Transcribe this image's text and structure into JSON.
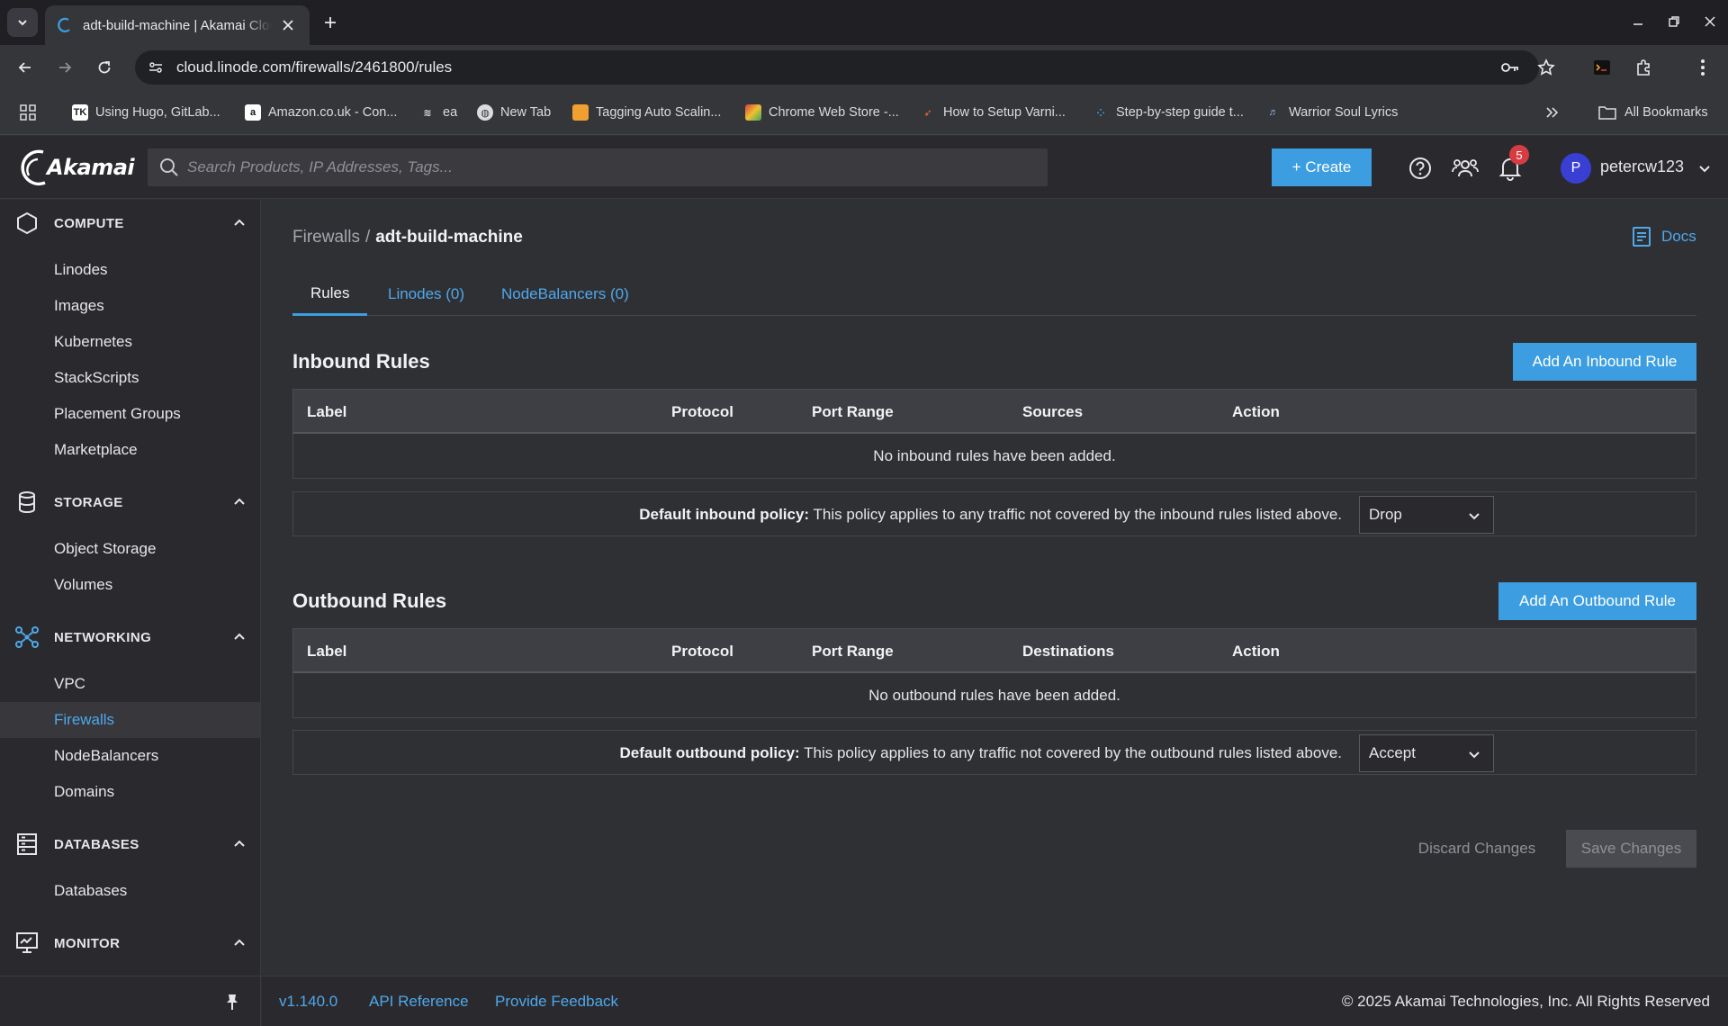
{
  "browser": {
    "tab_title": "adt-build-machine | Akamai Cloud Manager",
    "url": "cloud.linode.com/firewalls/2461800/rules",
    "bookmarks": [
      {
        "label": "Using Hugo, GitLab...",
        "icon": "tk-favicon"
      },
      {
        "label": "Amazon.co.uk - Con...",
        "icon": "amazon-favicon"
      },
      {
        "label": "ea",
        "icon": "stack-favicon"
      },
      {
        "label": "New Tab",
        "icon": "globe-favicon"
      },
      {
        "label": "Tagging Auto Scalin...",
        "icon": "aws-box-favicon"
      },
      {
        "label": "Chrome Web Store -...",
        "icon": "chrome-store-favicon"
      },
      {
        "label": "How to Setup Varni...",
        "icon": "rocket-favicon"
      },
      {
        "label": "Step-by-step guide t...",
        "icon": "dots-favicon"
      },
      {
        "label": "Warrior Soul Lyrics",
        "icon": "music-favicon"
      }
    ],
    "all_bookmarks": "All Bookmarks"
  },
  "header": {
    "logo": "Akamai",
    "search_placeholder": "Search Products, IP Addresses, Tags...",
    "create_label": "+ Create",
    "notification_count": "5",
    "avatar_letter": "P",
    "username": "petercw123"
  },
  "sidebar": {
    "sections": [
      {
        "label": "COMPUTE",
        "icon": "hexagon-icon",
        "items": [
          "Linodes",
          "Images",
          "Kubernetes",
          "StackScripts",
          "Placement Groups",
          "Marketplace"
        ]
      },
      {
        "label": "STORAGE",
        "icon": "database-cylinder-icon",
        "items": [
          "Object Storage",
          "Volumes"
        ]
      },
      {
        "label": "NETWORKING",
        "icon": "network-nodes-icon",
        "items": [
          "VPC",
          "Firewalls",
          "NodeBalancers",
          "Domains"
        ]
      },
      {
        "label": "DATABASES",
        "icon": "server-rack-icon",
        "items": [
          "Databases"
        ]
      },
      {
        "label": "MONITOR",
        "icon": "monitor-chart-icon",
        "items": []
      }
    ],
    "active_item": "Firewalls"
  },
  "main": {
    "breadcrumb_parent": "Firewalls",
    "breadcrumb_sep": "/",
    "breadcrumb_current": "adt-build-machine",
    "docs_label": "Docs",
    "tabs": [
      {
        "label": "Rules"
      },
      {
        "label": "Linodes (0)"
      },
      {
        "label": "NodeBalancers (0)"
      }
    ],
    "inbound": {
      "title": "Inbound Rules",
      "add_label": "Add An Inbound Rule",
      "columns": [
        "Label",
        "Protocol",
        "Port Range",
        "Sources",
        "Action"
      ],
      "empty": "No inbound rules have been added.",
      "policy_bold": "Default inbound policy:",
      "policy_text": " This policy applies to any traffic not covered by the inbound rules listed above.",
      "policy_value": "Drop"
    },
    "outbound": {
      "title": "Outbound Rules",
      "add_label": "Add An Outbound Rule",
      "columns": [
        "Label",
        "Protocol",
        "Port Range",
        "Destinations",
        "Action"
      ],
      "empty": "No outbound rules have been added.",
      "policy_bold": "Default outbound policy:",
      "policy_text": " This policy applies to any traffic not covered by the outbound rules listed above.",
      "policy_value": "Accept"
    },
    "discard_label": "Discard Changes",
    "save_label": "Save Changes"
  },
  "footer": {
    "version": "v1.140.0",
    "api_reference": "API Reference",
    "feedback": "Provide Feedback",
    "copyright": "© 2025 Akamai Technologies, Inc. All Rights Reserved"
  },
  "colors": {
    "accent": "#3c9ee0",
    "link": "#4ea8ea",
    "badge": "#d63c42",
    "avatar": "#3a3fd4"
  }
}
